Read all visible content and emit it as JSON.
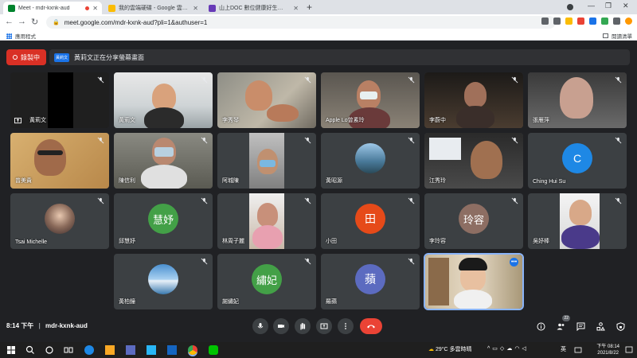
{
  "browser": {
    "tabs": [
      {
        "label": "Meet - mdr-kxnk-aud",
        "favicon_color": "#00832d",
        "active": true
      },
      {
        "label": "我的雲端硬碟 - Google 雲端硬碟",
        "favicon_color": "#fbbc04",
        "active": false
      },
      {
        "label": "山上DOC 數位健康好生活 - Goo",
        "favicon_color": "#673ab7",
        "active": false
      }
    ],
    "url": "meet.google.com/mdr-kxnk-aud?pli=1&authuser=1",
    "bookmarks_apps": "應用程式",
    "reading_list": "閱讀清單"
  },
  "meet": {
    "record_label": "錄製中",
    "share_badge": "黃莉文",
    "share_text": "黃莉文正在分享螢幕畫面",
    "participants": [
      {
        "name": "黃莉文",
        "type": "screen"
      },
      {
        "name": "黃莉文",
        "type": "video"
      },
      {
        "name": "李秀琴",
        "type": "video"
      },
      {
        "name": "Apple Lo曾素玲",
        "type": "video"
      },
      {
        "name": "李蔚中",
        "type": "video"
      },
      {
        "name": "張雁萍",
        "type": "video"
      },
      {
        "name": "曾美貴",
        "type": "video"
      },
      {
        "name": "陳信利",
        "type": "video"
      },
      {
        "name": "阿城陳",
        "type": "video"
      },
      {
        "name": "黃昭源",
        "type": "photo"
      },
      {
        "name": "江秀玲",
        "type": "video"
      },
      {
        "name": "Ching Hui Su",
        "type": "letter",
        "letter": "C",
        "color": "#1e88e5"
      },
      {
        "name": "Tsai Michelle",
        "type": "photo"
      },
      {
        "name": "邱慧妤",
        "type": "letter",
        "letter": "慧妤",
        "color": "#43a047"
      },
      {
        "name": "林周子麗",
        "type": "video"
      },
      {
        "name": "小田",
        "type": "letter",
        "letter": "田",
        "color": "#e64a19"
      },
      {
        "name": "李玲容",
        "type": "letter",
        "letter": "玲容",
        "color": "#8d6e63"
      },
      {
        "name": "吳妤棒",
        "type": "video"
      },
      {
        "name": "黃柏鐘",
        "type": "photo"
      },
      {
        "name": "謝繡妃",
        "type": "letter",
        "letter": "繡妃",
        "color": "#43a047"
      },
      {
        "name": "羅蘋",
        "type": "letter",
        "letter": "蘋",
        "color": "#5c6bc0"
      },
      {
        "name": "",
        "type": "self"
      }
    ],
    "time": "8:14 下午",
    "meeting_code": "mdr-kxnk-aud",
    "people_count": "22"
  },
  "taskbar": {
    "weather": "29°C 多雲時晴",
    "ime": "英",
    "time": "下午 08:14",
    "date": "2021/8/22"
  }
}
